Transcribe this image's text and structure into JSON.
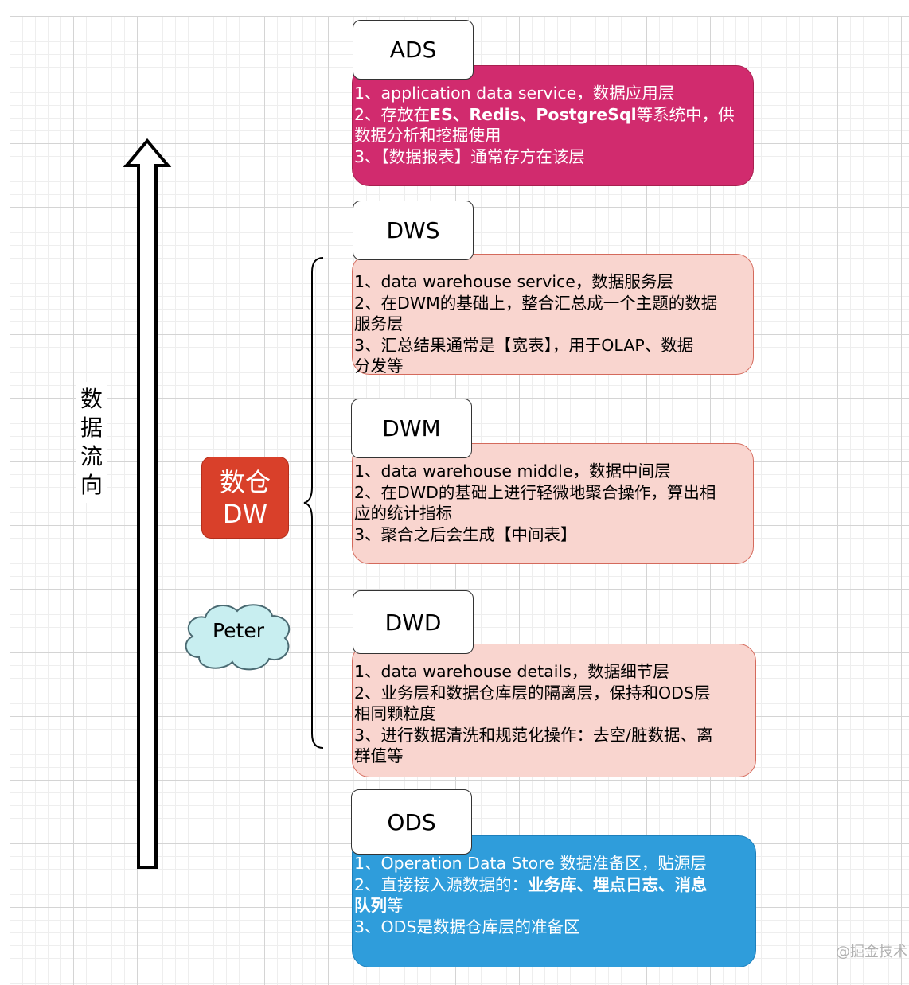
{
  "flow_label": [
    "数",
    "据",
    "流",
    "向"
  ],
  "dw_badge": {
    "line1": "数仓",
    "line2": "DW",
    "color": "#d9402a"
  },
  "cloud_label": "Peter",
  "watermark": "@掘金技术",
  "layers": {
    "ads": {
      "title": "ADS",
      "color": "#d12b6e",
      "lines": [
        [
          {
            "t": "1、application data service，数据应用层"
          }
        ],
        [
          {
            "t": "2、存放在"
          },
          {
            "t": "ES、Redis、PostgreSql",
            "b": true
          },
          {
            "t": "等系统中，供"
          }
        ],
        [
          {
            "t": "数据分析和挖掘使用"
          }
        ],
        [
          {
            "t": "3、【数据报表】通常存方在该层"
          }
        ]
      ]
    },
    "dws": {
      "title": "DWS",
      "color": "#f9d5cf",
      "lines": [
        [
          {
            "t": "1、data warehouse service，数据服务层"
          }
        ],
        [
          {
            "t": "2、在DWM的基础上，整合汇总成一个主题的数据"
          }
        ],
        [
          {
            "t": "服务层"
          }
        ],
        [
          {
            "t": "3、汇总结果通常是【宽表】，用于OLAP、数据"
          }
        ],
        [
          {
            "t": "分发等"
          }
        ]
      ]
    },
    "dwm": {
      "title": "DWM",
      "color": "#f9d5cf",
      "lines": [
        [
          {
            "t": "1、data warehouse middle，数据中间层"
          }
        ],
        [
          {
            "t": "2、在DWD的基础上进行轻微地聚合操作，算出相"
          }
        ],
        [
          {
            "t": "应的统计指标"
          }
        ],
        [
          {
            "t": "3、聚合之后会生成【中间表】"
          }
        ]
      ]
    },
    "dwd": {
      "title": "DWD",
      "color": "#f9d5cf",
      "lines": [
        [
          {
            "t": "1、data warehouse details，数据细节层"
          }
        ],
        [
          {
            "t": "2、业务层和数据仓库层的隔离层，保持和ODS层"
          }
        ],
        [
          {
            "t": "相同颗粒度"
          }
        ],
        [
          {
            "t": "3、进行数据清洗和规范化操作：去空/脏数据、离"
          }
        ],
        [
          {
            "t": "群值等"
          }
        ]
      ]
    },
    "ods": {
      "title": "ODS",
      "color": "#2f9ddb",
      "lines": [
        [
          {
            "t": "1、Operation Data Store 数据准备区，贴源层"
          }
        ],
        [
          {
            "t": "2、直接接入源数据的："
          },
          {
            "t": "业务库、埋点日志、消息",
            "b": true
          }
        ],
        [
          {
            "t": "队列",
            "b": true
          },
          {
            "t": "等"
          }
        ],
        [
          {
            "t": "3、ODS是数据仓库层的准备区"
          }
        ]
      ]
    }
  }
}
